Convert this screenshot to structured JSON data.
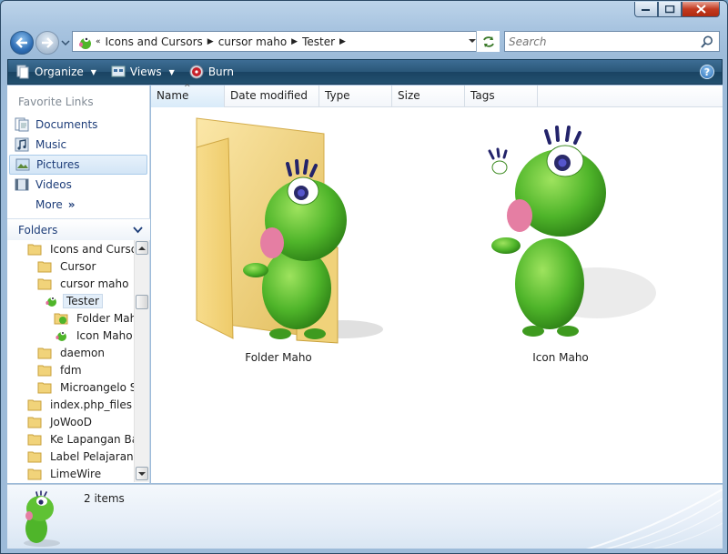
{
  "window": {
    "caption_buttons": [
      "minimize",
      "maximize",
      "close"
    ]
  },
  "nav": {
    "back_icon": "back-arrow-icon",
    "forward_icon": "forward-arrow-icon"
  },
  "address": {
    "overflow": "«",
    "crumbs": [
      "Icons and Cursors",
      "cursor maho",
      "Tester"
    ]
  },
  "search": {
    "placeholder": "Search"
  },
  "toolbar": {
    "organize": "Organize",
    "views": "Views",
    "burn": "Burn",
    "help": "?"
  },
  "sidebar": {
    "favorites_header": "Favorite Links",
    "favorites": [
      {
        "label": "Documents",
        "icon": "documents-icon"
      },
      {
        "label": "Music",
        "icon": "music-icon"
      },
      {
        "label": "Pictures",
        "icon": "pictures-icon",
        "selected": true
      },
      {
        "label": "Videos",
        "icon": "videos-icon"
      },
      {
        "label": "More",
        "suffix": "»"
      }
    ],
    "folders_header": "Folders",
    "tree": [
      {
        "label": "Icons and Cursors",
        "level": 0
      },
      {
        "label": "Cursor",
        "level": 1
      },
      {
        "label": "cursor maho",
        "level": 1
      },
      {
        "label": "Tester",
        "level": 2,
        "selected": true
      },
      {
        "label": "Folder Maho",
        "level": 3
      },
      {
        "label": "Icon Maho",
        "level": 3
      },
      {
        "label": "daemon",
        "level": 1
      },
      {
        "label": "fdm",
        "level": 1
      },
      {
        "label": "Microangelo Sar",
        "level": 1
      },
      {
        "label": "index.php_files",
        "level": 0
      },
      {
        "label": "JoWooD",
        "level": 0
      },
      {
        "label": "Ke Lapangan Bant",
        "level": 0
      },
      {
        "label": "Label Pelajaran",
        "level": 0
      },
      {
        "label": "LimeWire",
        "level": 0
      }
    ]
  },
  "columns": [
    "Name",
    "Date modified",
    "Type",
    "Size",
    "Tags"
  ],
  "items": [
    {
      "label": "Folder Maho",
      "kind": "folder-with-character-icon"
    },
    {
      "label": "Icon Maho",
      "kind": "character-icon"
    }
  ],
  "details": {
    "count": "2 items"
  },
  "colors": {
    "toolbar": "#23506f",
    "link": "#1c3c78",
    "selection": "#d3e5f6",
    "character_green": "#4fb52a"
  }
}
